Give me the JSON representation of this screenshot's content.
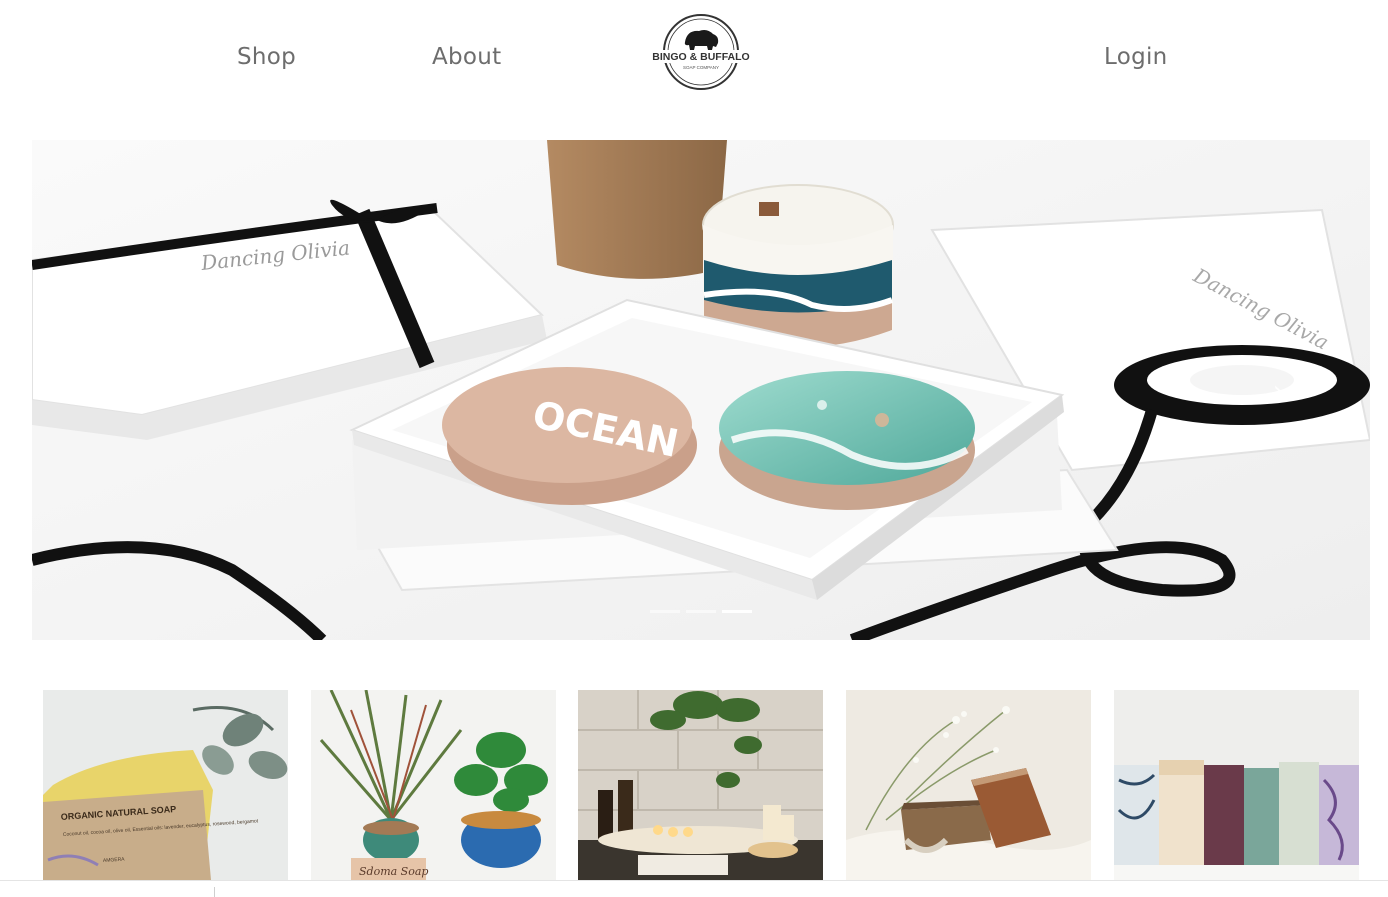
{
  "nav": {
    "shop_label": "Shop",
    "about_label": "About",
    "login_label": "Login",
    "logo": {
      "brand_line1": "BINGO & BUFFALO",
      "brand_line2": "SOAP COMPANY",
      "icon": "buffalo-icon"
    }
  },
  "carousel": {
    "prev_icon": "chevron-left-icon",
    "next_icon": "chevron-right-icon",
    "prev_glyph": "‹",
    "next_glyph": "›",
    "slide_count": 3,
    "active_slide": 3,
    "slide_texts": {
      "box_signature": "Dancing Olivia",
      "soap_word": "OCEAN"
    }
  },
  "products": [
    {
      "label_text": "ORGANIC NATURAL SOAP",
      "label_small": "Coconut oil, cocoa oil, olive oil, Essential oils: lavender, eucalyptus, rosewood, bergamot",
      "label_brand": "AMGERA"
    },
    {
      "label_text": "Sdoma Soap"
    },
    {},
    {},
    {}
  ],
  "colors": {
    "nav_text": "#6d6d6d",
    "ribbon": "#111111",
    "soap_pink": "#d9b39e",
    "soap_teal": "#7fc4b8"
  }
}
